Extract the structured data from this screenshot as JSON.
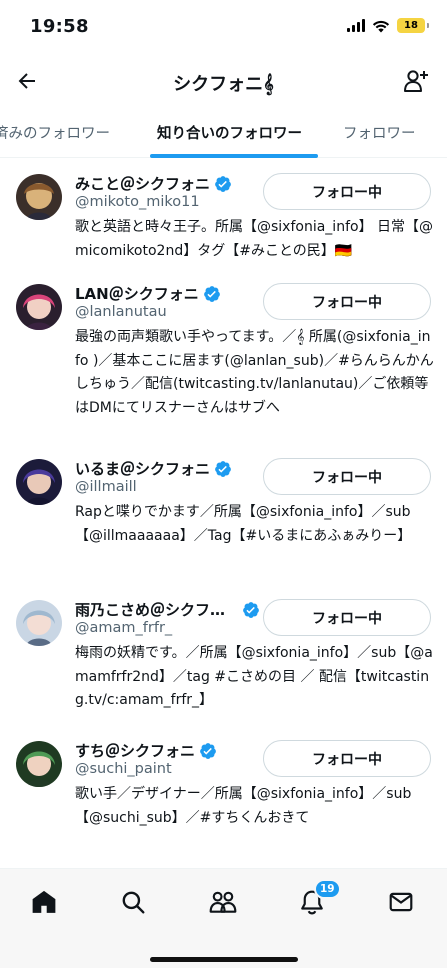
{
  "status_bar": {
    "time": "19:58",
    "battery": "18",
    "icons": [
      "signal-icon",
      "wifi-icon",
      "battery-icon"
    ]
  },
  "header": {
    "title": "シクフォニ𝄞",
    "back_icon": "arrow-left-icon",
    "add_icon": "add-user-icon"
  },
  "tabs": [
    {
      "label": "済みのフォロワー",
      "active": false
    },
    {
      "label": "知り合いのフォロワー",
      "active": true
    },
    {
      "label": "フォロワー",
      "active": false
    }
  ],
  "users": [
    {
      "name": "みこと＠シクフォニ",
      "handle": "@mikoto_miko11",
      "button": "フォロー中",
      "bio": "歌と英語と時々王子。所属【@sixfonia_info】 日常【@micomikoto2nd】タグ【#みことの民】🇩🇪",
      "avatar_colors": [
        "#3b2f2a",
        "#d9b27a"
      ]
    },
    {
      "name": "LAN＠シクフォニ",
      "handle": "@lanlanutau",
      "button": "フォロー中",
      "bio": "最強の両声類歌い手やってます。／𝄞 所属(@sixfonia_info )／基本ここに居ます(@lanlan_sub)／#らんらんかんしちゅう／配信(twitcasting.tv/lanlanutau)／ご依頼等はDMにてリスナーさんはサブへ",
      "avatar_colors": [
        "#2a1f2e",
        "#d9447a"
      ]
    },
    {
      "name": "いるま＠シクフォニ",
      "handle": "@illmaill",
      "button": "フォロー中",
      "bio": "Rapと喋りでかます／所属【@sixfonia_info】／sub【@illmaaaaaa】／Tag【#いるまにあふぁみりー】",
      "avatar_colors": [
        "#1c1b3a",
        "#6b4fc4"
      ]
    },
    {
      "name": "雨乃こさめ＠シクフォニ",
      "handle": "@amam_frfr_",
      "button": "フォロー中",
      "bio": "梅雨の妖精です。／所属【@sixfonia_info】／sub【@amamfrfr2nd】／tag #こさめの目 ／ 配信【twitcasting.tv/c:amam_frfr_】",
      "avatar_colors": [
        "#9fb8cf",
        "#e8eef6"
      ]
    },
    {
      "name": "すち＠シクフォニ",
      "handle": "@suchi_paint",
      "button": "フォロー中",
      "bio": "歌い手／デザイナー／所属【@sixfonia_info】／sub【@suchi_sub】／#すちくんおきて",
      "avatar_colors": [
        "#1f3a22",
        "#4f9a55"
      ]
    }
  ],
  "bottom_nav": {
    "items": [
      "home-icon",
      "search-icon",
      "communities-icon",
      "notifications-icon",
      "messages-icon"
    ],
    "notification_count": "19"
  },
  "colors": {
    "accent": "#1d9bf0",
    "text": "#0f1419",
    "secondary": "#536471"
  }
}
